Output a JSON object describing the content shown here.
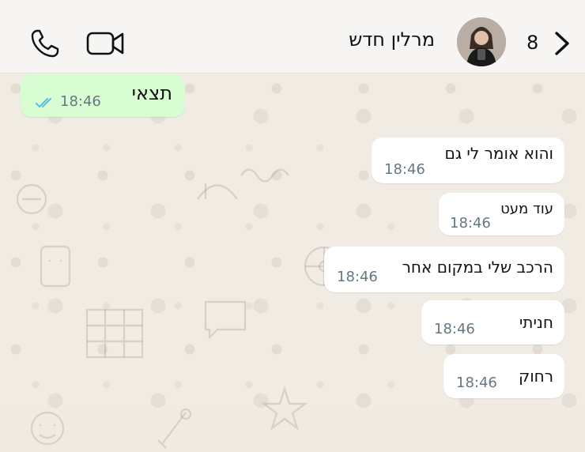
{
  "header": {
    "contact_name": "מרלין חדש",
    "unread_count": "8",
    "icons": {
      "call": "phone-icon",
      "video": "video-camera-icon",
      "back": "chevron-right-icon"
    }
  },
  "messages": [
    {
      "direction": "outgoing",
      "text": "תצאי",
      "time": "18:46",
      "status": "read"
    },
    {
      "direction": "incoming",
      "text": "והוא אומר לי גם",
      "time": "18:46"
    },
    {
      "direction": "incoming",
      "text": "עוד מעט",
      "time": "18:46"
    },
    {
      "direction": "incoming",
      "text": "הרכב שלי במקום אחר",
      "time": "18:46"
    },
    {
      "direction": "incoming",
      "text": "חניתי",
      "time": "18:46"
    },
    {
      "direction": "incoming",
      "text": "רחוק",
      "time": "18:46"
    }
  ],
  "colors": {
    "outgoing_bubble": "#d9fdd3",
    "incoming_bubble": "#ffffff",
    "read_ticks": "#53bdeb",
    "wallpaper": "#f0ebe3"
  }
}
